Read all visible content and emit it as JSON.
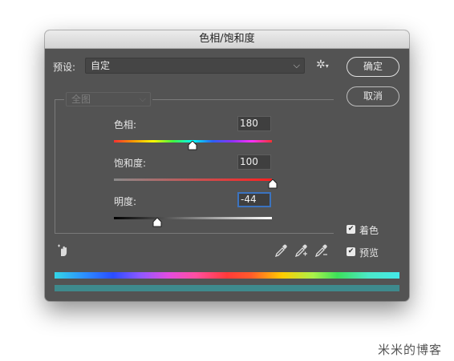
{
  "dialog": {
    "title": "色相/饱和度",
    "preset_label": "预设:",
    "preset_value": "自定",
    "channel_value": "全图",
    "ok_label": "确定",
    "cancel_label": "取消"
  },
  "sliders": {
    "hue": {
      "label": "色相:",
      "value": "180"
    },
    "saturation": {
      "label": "饱和度:",
      "value": "100"
    },
    "lightness": {
      "label": "明度:",
      "value": "-44"
    }
  },
  "options": {
    "colorize_label": "着色",
    "colorize_checked": true,
    "preview_label": "预览",
    "preview_checked": true
  },
  "colors": {
    "dialog_bg": "#535353",
    "focus_ring": "#3b73c0",
    "result_bar": "#3e8a8d"
  },
  "icons": [
    "gear-icon",
    "hand-adjust-icon",
    "eyedropper-icon",
    "eyedropper-add-icon",
    "eyedropper-subtract-icon",
    "checkmark-icon",
    "chevron-down-icon"
  ],
  "watermark": "米米的博客"
}
